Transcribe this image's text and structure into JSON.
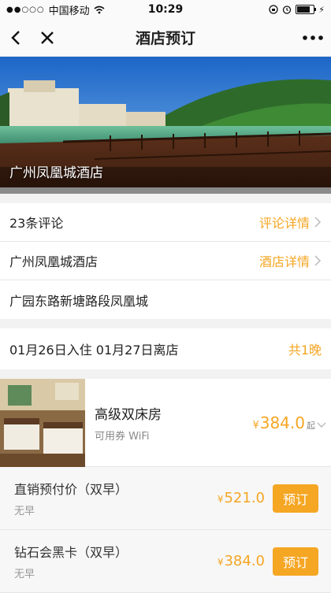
{
  "status_bar": {
    "carrier": "中国移动",
    "time": "10:29"
  },
  "nav": {
    "title": "酒店预订"
  },
  "banner": {
    "caption": "广州凤凰城酒店"
  },
  "info_rows": [
    {
      "label": "23条评论",
      "link": "评论详情"
    },
    {
      "label": "广州凤凰城酒店",
      "link": "酒店详情"
    },
    {
      "label": "广园东路新塘路段凤凰城",
      "link": ""
    }
  ],
  "stay": {
    "dates": "01月26日入住 01月27日离店",
    "nights": "共1晚"
  },
  "room": {
    "name": "高级双床房",
    "tags": "可用券 WiFi",
    "currency": "¥",
    "price": "384.0",
    "from": "起"
  },
  "rates": [
    {
      "name": "直销预付价（双早）",
      "sub": "无早",
      "currency": "¥",
      "price": "521.0",
      "button": "预订"
    },
    {
      "name": "钻石会黑卡（双早）",
      "sub": "无早",
      "currency": "¥",
      "price": "384.0",
      "button": "预订"
    }
  ],
  "colors": {
    "accent": "#f5a623"
  }
}
